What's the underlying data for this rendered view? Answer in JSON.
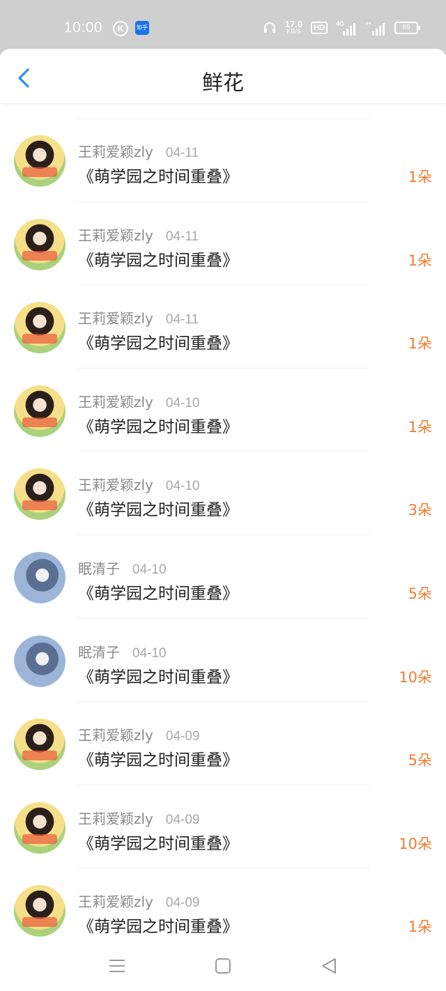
{
  "status_bar": {
    "time": "10:00",
    "k_icon": "K",
    "app_icon_label": "知乎",
    "speed_value": "17.0",
    "speed_unit": "KB/S",
    "hd": "HD",
    "net1": "4G",
    "net2": "⁴⁶",
    "battery": "89"
  },
  "header": {
    "title": "鲜花"
  },
  "records": [
    {
      "user": "王莉爱颖zly",
      "date": "04-11",
      "book": "《萌学园之时间重叠》",
      "count": "1朵",
      "avatar": "girl"
    },
    {
      "user": "王莉爱颖zly",
      "date": "04-11",
      "book": "《萌学园之时间重叠》",
      "count": "1朵",
      "avatar": "girl"
    },
    {
      "user": "王莉爱颖zly",
      "date": "04-11",
      "book": "《萌学园之时间重叠》",
      "count": "1朵",
      "avatar": "girl"
    },
    {
      "user": "王莉爱颖zly",
      "date": "04-10",
      "book": "《萌学园之时间重叠》",
      "count": "1朵",
      "avatar": "girl"
    },
    {
      "user": "王莉爱颖zly",
      "date": "04-10",
      "book": "《萌学园之时间重叠》",
      "count": "3朵",
      "avatar": "girl"
    },
    {
      "user": "眠清子",
      "date": "04-10",
      "book": "《萌学园之时间重叠》",
      "count": "5朵",
      "avatar": "anime"
    },
    {
      "user": "眠清子",
      "date": "04-10",
      "book": "《萌学园之时间重叠》",
      "count": "10朵",
      "avatar": "anime"
    },
    {
      "user": "王莉爱颖zly",
      "date": "04-09",
      "book": "《萌学园之时间重叠》",
      "count": "5朵",
      "avatar": "girl"
    },
    {
      "user": "王莉爱颖zly",
      "date": "04-09",
      "book": "《萌学园之时间重叠》",
      "count": "10朵",
      "avatar": "girl"
    },
    {
      "user": "王莉爱颖zly",
      "date": "04-09",
      "book": "《萌学园之时间重叠》",
      "count": "1朵",
      "avatar": "girl"
    }
  ],
  "colors": {
    "accent_blue": "#2d8cf0",
    "count_orange": "#f07c30",
    "status_bar_bg": "#cfcfcf"
  },
  "icons": {
    "back": "chevron-left-icon",
    "nav_menu": "menu-icon",
    "nav_home": "home-square-icon",
    "nav_back": "back-triangle-icon"
  }
}
